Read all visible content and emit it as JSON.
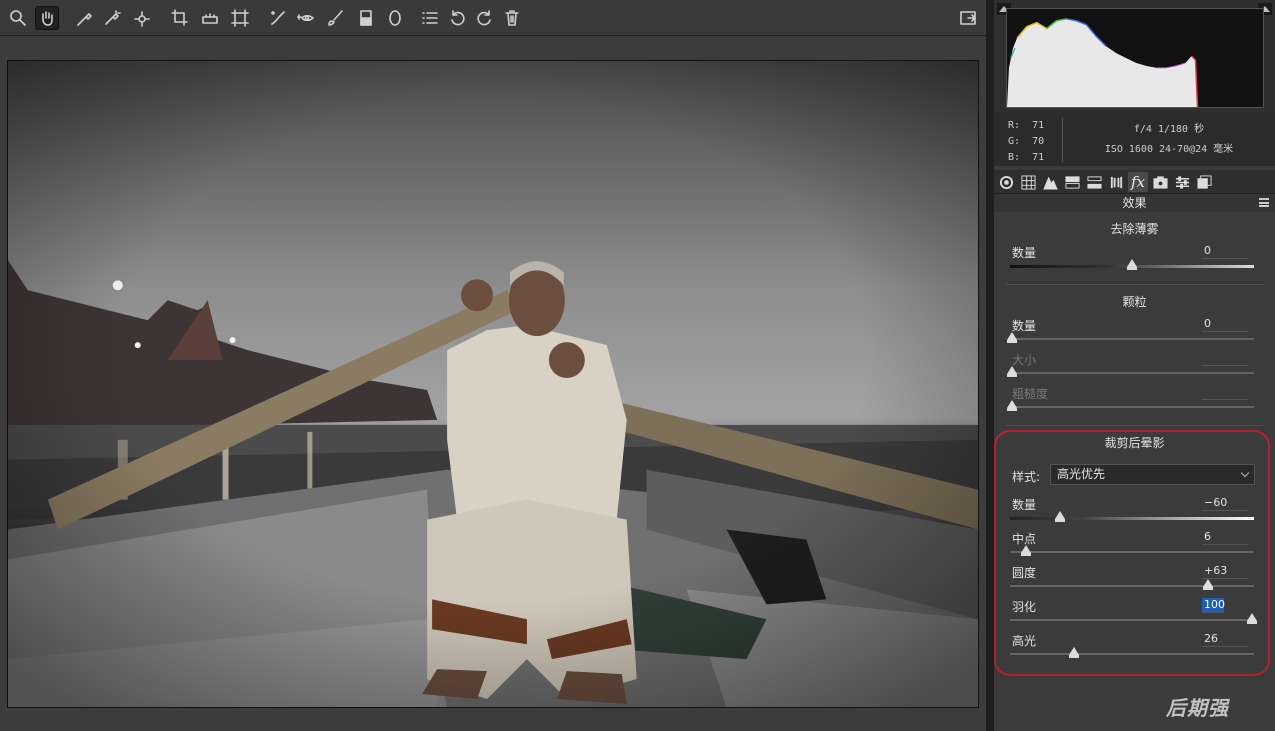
{
  "toolbar": {
    "tools": [
      "zoom-tool",
      "hand-tool",
      "white-balance-tool",
      "color-sampler-tool",
      "targeted-adjustment-tool",
      "crop-tool",
      "straighten-tool",
      "transform-tool",
      "spot-removal-tool",
      "red-eye-tool",
      "adjustment-brush-tool",
      "graduated-filter-tool",
      "radial-filter-tool",
      "preferences",
      "rotate-left",
      "rotate-right",
      "delete"
    ]
  },
  "info": {
    "r": "R:  71",
    "g": "G:  70",
    "b": "B:  71",
    "exposure": "f/4  1/180 秒",
    "iso_lens": "ISO 1600  24-70@24 毫米"
  },
  "panel": {
    "section_title": "效果",
    "dehaze": {
      "title": "去除薄雾",
      "amount_label": "数量",
      "amount_value": "0",
      "amount": 0
    },
    "grain": {
      "title": "颗粒",
      "amount_label": "数量",
      "amount_value": "0",
      "size_label": "大小",
      "roughness_label": "粗糙度"
    },
    "vignette": {
      "title": "裁剪后晕影",
      "style_label": "样式:",
      "style_value": "高光优先",
      "amount_label": "数量",
      "amount_value": "−60",
      "midpoint_label": "中点",
      "midpoint_value": "6",
      "roundness_label": "圆度",
      "roundness_value": "+63",
      "feather_label": "羽化",
      "feather_value": "100",
      "highlights_label": "高光",
      "highlights_value": "26"
    }
  },
  "watermark": "后期强",
  "colors": {
    "accent_red": "#b3232b",
    "selection_blue": "#1d5fb5"
  }
}
